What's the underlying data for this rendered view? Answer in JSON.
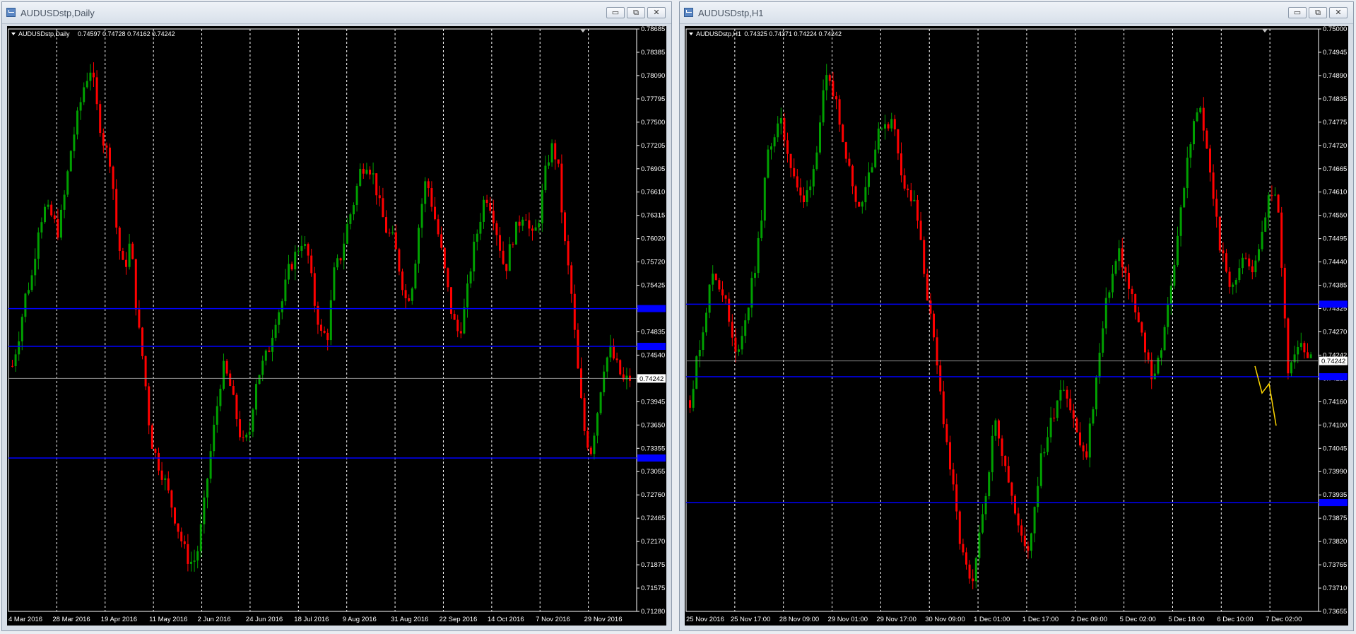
{
  "windows": [
    {
      "id": "daily",
      "title": "AUDUSDstp,Daily",
      "info": {
        "symbol": "AUDUSDstp,Daily",
        "ohlc": "0.74597 0.74728 0.74162 0.74242"
      },
      "controls": {
        "minimize": "▭",
        "restore": "⧉",
        "close": "✕"
      },
      "colors": {
        "bull": "#00a000",
        "bear": "#ff0000",
        "level": "#0000ff",
        "bid": "#8c8c8c",
        "grid": "#ffffff",
        "background": "#000000"
      },
      "price_labels": [
        "0.78685",
        "0.78385",
        "0.78090",
        "0.77795",
        "0.77500",
        "0.77205",
        "0.76905",
        "0.76610",
        "0.76315",
        "0.76020",
        "0.75720",
        "0.75425",
        "0.75130",
        "0.74835",
        "0.74540",
        "0.74242",
        "0.73945",
        "0.73650",
        "0.73355",
        "0.73055",
        "0.72760",
        "0.72465",
        "0.72170",
        "0.71875",
        "0.71575",
        "0.71280"
      ],
      "time_labels": [
        "4 Mar 2016",
        "28 Mar 2016",
        "19 Apr 2016",
        "11 May 2016",
        "2 Jun 2016",
        "24 Jun 2016",
        "18 Jul 2016",
        "9 Aug 2016",
        "31 Aug 2016",
        "22 Sep 2016",
        "14 Oct 2016",
        "7 Nov 2016",
        "29 Nov 2016"
      ],
      "chart_data": {
        "type": "candlestick",
        "price_range": [
          0.7128,
          0.78685
        ],
        "current_bid": 0.74242,
        "horizontal_levels": [
          0.7513,
          0.7465,
          0.7323
        ],
        "close_path": [
          0.744,
          0.748,
          0.753,
          0.7555,
          0.762,
          0.764,
          0.763,
          0.761,
          0.766,
          0.772,
          0.776,
          0.78,
          0.782,
          0.776,
          0.772,
          0.77,
          0.76,
          0.756,
          0.76,
          0.75,
          0.744,
          0.735,
          0.732,
          0.73,
          0.727,
          0.724,
          0.721,
          0.719,
          0.7195,
          0.725,
          0.732,
          0.738,
          0.744,
          0.742,
          0.738,
          0.734,
          0.735,
          0.742,
          0.744,
          0.746,
          0.75,
          0.752,
          0.756,
          0.758,
          0.76,
          0.758,
          0.752,
          0.748,
          0.748,
          0.756,
          0.758,
          0.762,
          0.765,
          0.769,
          0.77,
          0.768,
          0.764,
          0.761,
          0.76,
          0.756,
          0.752,
          0.755,
          0.763,
          0.768,
          0.764,
          0.76,
          0.755,
          0.75,
          0.748,
          0.752,
          0.758,
          0.762,
          0.766,
          0.764,
          0.76,
          0.756,
          0.76,
          0.762,
          0.764,
          0.76,
          0.762,
          0.768,
          0.772,
          0.77,
          0.76,
          0.754,
          0.744,
          0.736,
          0.733,
          0.738,
          0.744,
          0.746,
          0.744,
          0.742,
          0.7424
        ]
      }
    },
    {
      "id": "h1",
      "title": "AUDUSDstp,H1",
      "info": {
        "symbol": "AUDUSDstp,H1",
        "ohlc": "0.74325 0.74371 0.74224 0.74242"
      },
      "controls": {
        "minimize": "▭",
        "restore": "⧉",
        "close": "✕"
      },
      "colors": {
        "bull": "#00a000",
        "bear": "#ff0000",
        "level": "#0000ff",
        "bid": "#8c8c8c",
        "grid": "#ffffff",
        "background": "#000000",
        "arrow": "#ffd700"
      },
      "price_labels": [
        "0.75000",
        "0.74945",
        "0.74890",
        "0.74835",
        "0.74775",
        "0.74720",
        "0.74665",
        "0.74610",
        "0.74550",
        "0.74495",
        "0.74440",
        "0.74385",
        "0.74325",
        "0.74270",
        "0.74242",
        "0.74215",
        "0.74160",
        "0.74100",
        "0.74045",
        "0.73990",
        "0.73935",
        "0.73875",
        "0.73820",
        "0.73765",
        "0.73710",
        "0.73655"
      ],
      "time_labels": [
        "25 Nov 2016",
        "25 Nov 17:00",
        "28 Nov 09:00",
        "29 Nov 01:00",
        "29 Nov 17:00",
        "30 Nov 09:00",
        "1 Dec 01:00",
        "1 Dec 17:00",
        "2 Dec 09:00",
        "5 Dec 02:00",
        "5 Dec 18:00",
        "6 Dec 10:00",
        "7 Dec 02:00"
      ],
      "chart_data": {
        "type": "candlestick",
        "price_range": [
          0.73655,
          0.7502
        ],
        "current_bid": 0.74242,
        "horizontal_levels": [
          0.74375,
          0.74205,
          0.7391
        ],
        "close_path": [
          0.7415,
          0.743,
          0.7445,
          0.744,
          0.7425,
          0.7435,
          0.745,
          0.7475,
          0.748,
          0.747,
          0.746,
          0.747,
          0.749,
          0.7485,
          0.747,
          0.746,
          0.747,
          0.748,
          0.748,
          0.7465,
          0.746,
          0.744,
          0.742,
          0.74,
          0.738,
          0.737,
          0.739,
          0.741,
          0.74,
          0.7385,
          0.738,
          0.74,
          0.741,
          0.742,
          0.741,
          0.74,
          0.742,
          0.744,
          0.745,
          0.744,
          0.743,
          0.742,
          0.743,
          0.745,
          0.747,
          0.7485,
          0.747,
          0.745,
          0.744,
          0.745,
          0.7445,
          0.746,
          0.7465,
          0.742,
          0.743,
          0.7424
        ],
        "projection": [
          [
            0.7423,
            0
          ],
          [
            0.7418,
            1
          ],
          [
            0.74215,
            2
          ],
          [
            0.7413,
            3
          ]
        ]
      }
    }
  ]
}
